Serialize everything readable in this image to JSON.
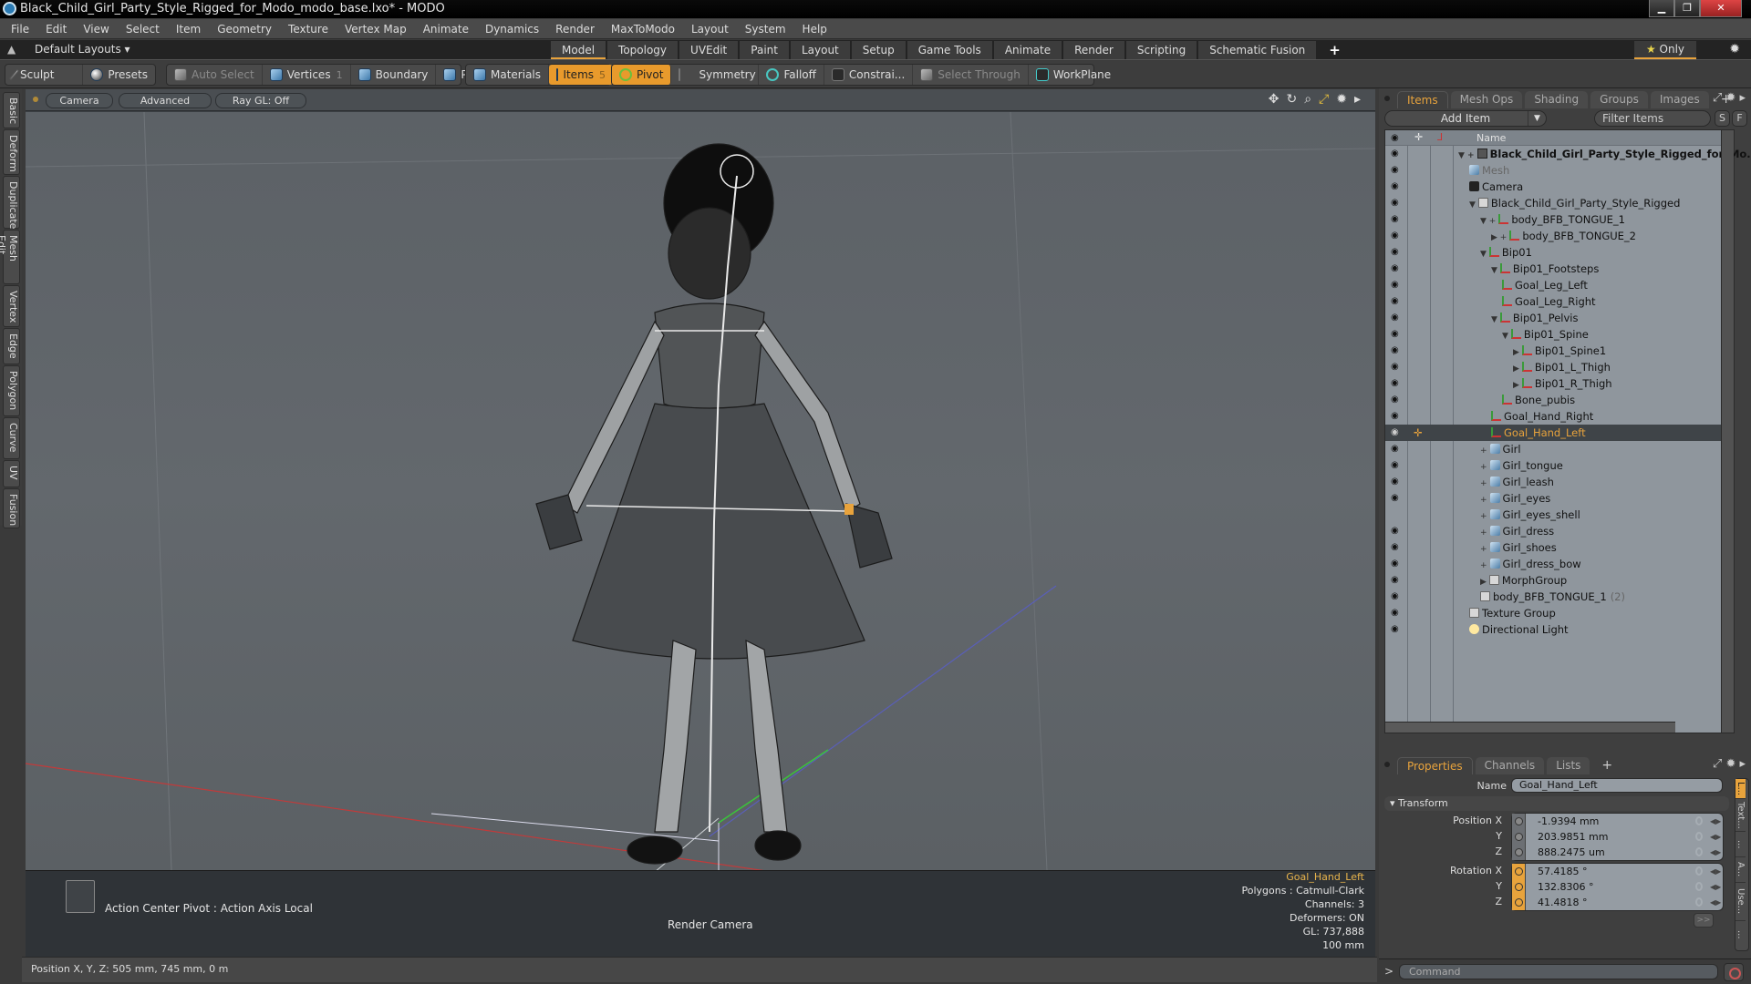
{
  "window": {
    "title": "Black_Child_Girl_Party_Style_Rigged_for_Modo_modo_base.lxo* - MODO",
    "minimize": "▁",
    "maximize": "❐",
    "close": "✕"
  },
  "menu": [
    "File",
    "Edit",
    "View",
    "Select",
    "Item",
    "Geometry",
    "Texture",
    "Vertex Map",
    "Animate",
    "Dynamics",
    "Render",
    "MaxToModo",
    "Layout",
    "System",
    "Help"
  ],
  "layout": {
    "preset": "Default Layouts ▾",
    "tabs": [
      "Model",
      "Topology",
      "UVEdit",
      "Paint",
      "Layout",
      "Setup",
      "Game Tools",
      "Animate",
      "Render",
      "Scripting",
      "Schematic Fusion"
    ],
    "active_tab": "Model",
    "add_tab": "+",
    "only": "Only",
    "star": "★"
  },
  "toolbar": {
    "sculpt": "Sculpt",
    "presets": "Presets",
    "auto_select": "Auto Select",
    "vertices": "Vertices",
    "vertices_count": "1",
    "boundary": "Boundary",
    "polygons": "Polygons",
    "materials": "Materials",
    "items": "Items",
    "items_count": "5",
    "pivot": "Pivot",
    "symmetry": "Symmetry",
    "falloff": "Falloff",
    "constraints": "Constrai...",
    "select_through": "Select Through",
    "workplane": "WorkPlane"
  },
  "left_tabs": [
    "Basic",
    "Deform",
    "Duplicate",
    "Mesh Edit",
    "Vertex",
    "Edge",
    "Polygon",
    "Curve",
    "UV",
    "Fusion"
  ],
  "viewport": {
    "buttons": [
      "Camera",
      "Advanced",
      "Ray GL: Off"
    ],
    "action_center": "Action Center Pivot : Action Axis Local",
    "camera_label": "Render Camera",
    "info": {
      "selected": "Goal_Hand_Left",
      "polygons": "Polygons : Catmull-Clark",
      "channels": "Channels: 3",
      "deformers": "Deformers: ON",
      "gl": "GL: 737,888",
      "scale": "100 mm"
    }
  },
  "statusbar": {
    "position": "Position X, Y, Z:   505 mm, 745 mm, 0 m"
  },
  "items_panel": {
    "tabs": [
      "Items",
      "Mesh Ops",
      "Shading",
      "Groups",
      "Images"
    ],
    "active_tab": "Items",
    "add_item": "Add Item",
    "filter_placeholder": "Filter Items",
    "s_btn": "S",
    "f_btn": "F",
    "column_name": "Name",
    "tree": [
      {
        "label": "Black_Child_Girl_Party_Style_Rigged_for_Mo...",
        "depth": 0,
        "icon": "scene",
        "toggle": "▼ +",
        "bold": true,
        "eye": true
      },
      {
        "label": "Mesh",
        "depth": 1,
        "icon": "mesh",
        "toggle": "",
        "muted": true,
        "eye": true
      },
      {
        "label": "Camera",
        "depth": 1,
        "icon": "cam",
        "toggle": "",
        "eye": true
      },
      {
        "label": "Black_Child_Girl_Party_Style_Rigged",
        "depth": 1,
        "icon": "folder",
        "toggle": "▼",
        "eye": true
      },
      {
        "label": "body_BFB_TONGUE_1",
        "depth": 2,
        "icon": "loc",
        "toggle": "▼ +",
        "eye": true
      },
      {
        "label": "body_BFB_TONGUE_2",
        "depth": 3,
        "icon": "loc",
        "toggle": "▶ +",
        "eye": true
      },
      {
        "label": "Bip01",
        "depth": 2,
        "icon": "loc",
        "toggle": "▼",
        "eye": true
      },
      {
        "label": "Bip01_Footsteps",
        "depth": 3,
        "icon": "loc",
        "toggle": "▼",
        "eye": true
      },
      {
        "label": "Goal_Leg_Left",
        "depth": 4,
        "icon": "loc",
        "toggle": "",
        "eye": true
      },
      {
        "label": "Goal_Leg_Right",
        "depth": 4,
        "icon": "loc",
        "toggle": "",
        "eye": true
      },
      {
        "label": "Bip01_Pelvis",
        "depth": 3,
        "icon": "loc",
        "toggle": "▼",
        "eye": true
      },
      {
        "label": "Bip01_Spine",
        "depth": 4,
        "icon": "loc",
        "toggle": "▼",
        "eye": true
      },
      {
        "label": "Bip01_Spine1",
        "depth": 5,
        "icon": "loc",
        "toggle": "▶",
        "eye": true
      },
      {
        "label": "Bip01_L_Thigh",
        "depth": 5,
        "icon": "loc",
        "toggle": "▶",
        "eye": true
      },
      {
        "label": "Bip01_R_Thigh",
        "depth": 5,
        "icon": "loc",
        "toggle": "▶",
        "eye": true
      },
      {
        "label": "Bone_pubis",
        "depth": 4,
        "icon": "loc",
        "toggle": "",
        "eye": true
      },
      {
        "label": "Goal_Hand_Right",
        "depth": 3,
        "icon": "loc",
        "toggle": "",
        "eye": true
      },
      {
        "label": "Goal_Hand_Left",
        "depth": 3,
        "icon": "loc",
        "toggle": "",
        "eye": true,
        "selected": true
      },
      {
        "label": "Girl",
        "depth": 2,
        "icon": "mesh",
        "toggle": "+",
        "eye": true
      },
      {
        "label": "Girl_tongue",
        "depth": 2,
        "icon": "mesh",
        "toggle": "+",
        "eye": true
      },
      {
        "label": "Girl_leash",
        "depth": 2,
        "icon": "mesh",
        "toggle": "+",
        "eye": true
      },
      {
        "label": "Girl_eyes",
        "depth": 2,
        "icon": "mesh",
        "toggle": "+",
        "eye": true
      },
      {
        "label": "Girl_eyes_shell",
        "depth": 2,
        "icon": "mesh",
        "toggle": "+",
        "eye": false
      },
      {
        "label": "Girl_dress",
        "depth": 2,
        "icon": "mesh",
        "toggle": "+",
        "eye": true
      },
      {
        "label": "Girl_shoes",
        "depth": 2,
        "icon": "mesh",
        "toggle": "+",
        "eye": true
      },
      {
        "label": "Girl_dress_bow",
        "depth": 2,
        "icon": "mesh",
        "toggle": "+",
        "eye": true
      },
      {
        "label": "MorphGroup",
        "depth": 2,
        "icon": "folder",
        "toggle": "▶",
        "eye": true
      },
      {
        "label": "body_BFB_TONGUE_1",
        "suffix": "(2)",
        "depth": 2,
        "icon": "folder",
        "toggle": "",
        "eye": true
      },
      {
        "label": "Texture Group",
        "depth": 1,
        "icon": "folder",
        "toggle": "",
        "eye": true
      },
      {
        "label": "Directional Light",
        "depth": 1,
        "icon": "light",
        "toggle": "",
        "eye": true
      }
    ]
  },
  "properties_panel": {
    "tabs": [
      "Properties",
      "Channels",
      "Lists"
    ],
    "active_tab": "Properties",
    "name_label": "Name",
    "name_value": "Goal_Hand_Left",
    "section": "Transform",
    "position": {
      "label": "Position X",
      "x": "-1.9394 mm",
      "y": "203.9851 mm",
      "z": "888.2475 um"
    },
    "rotation": {
      "label": "Rotation X",
      "x": "57.4185 °",
      "y": "132.8306 °",
      "z": "41.4818 °"
    },
    "axis_y": "Y",
    "axis_z": "Z",
    "more": ">>",
    "side_tabs": [
      "L...",
      "Text...",
      "...",
      "A...",
      "Use...",
      "..."
    ]
  },
  "command": {
    "prompt": ">",
    "placeholder": "Command"
  }
}
